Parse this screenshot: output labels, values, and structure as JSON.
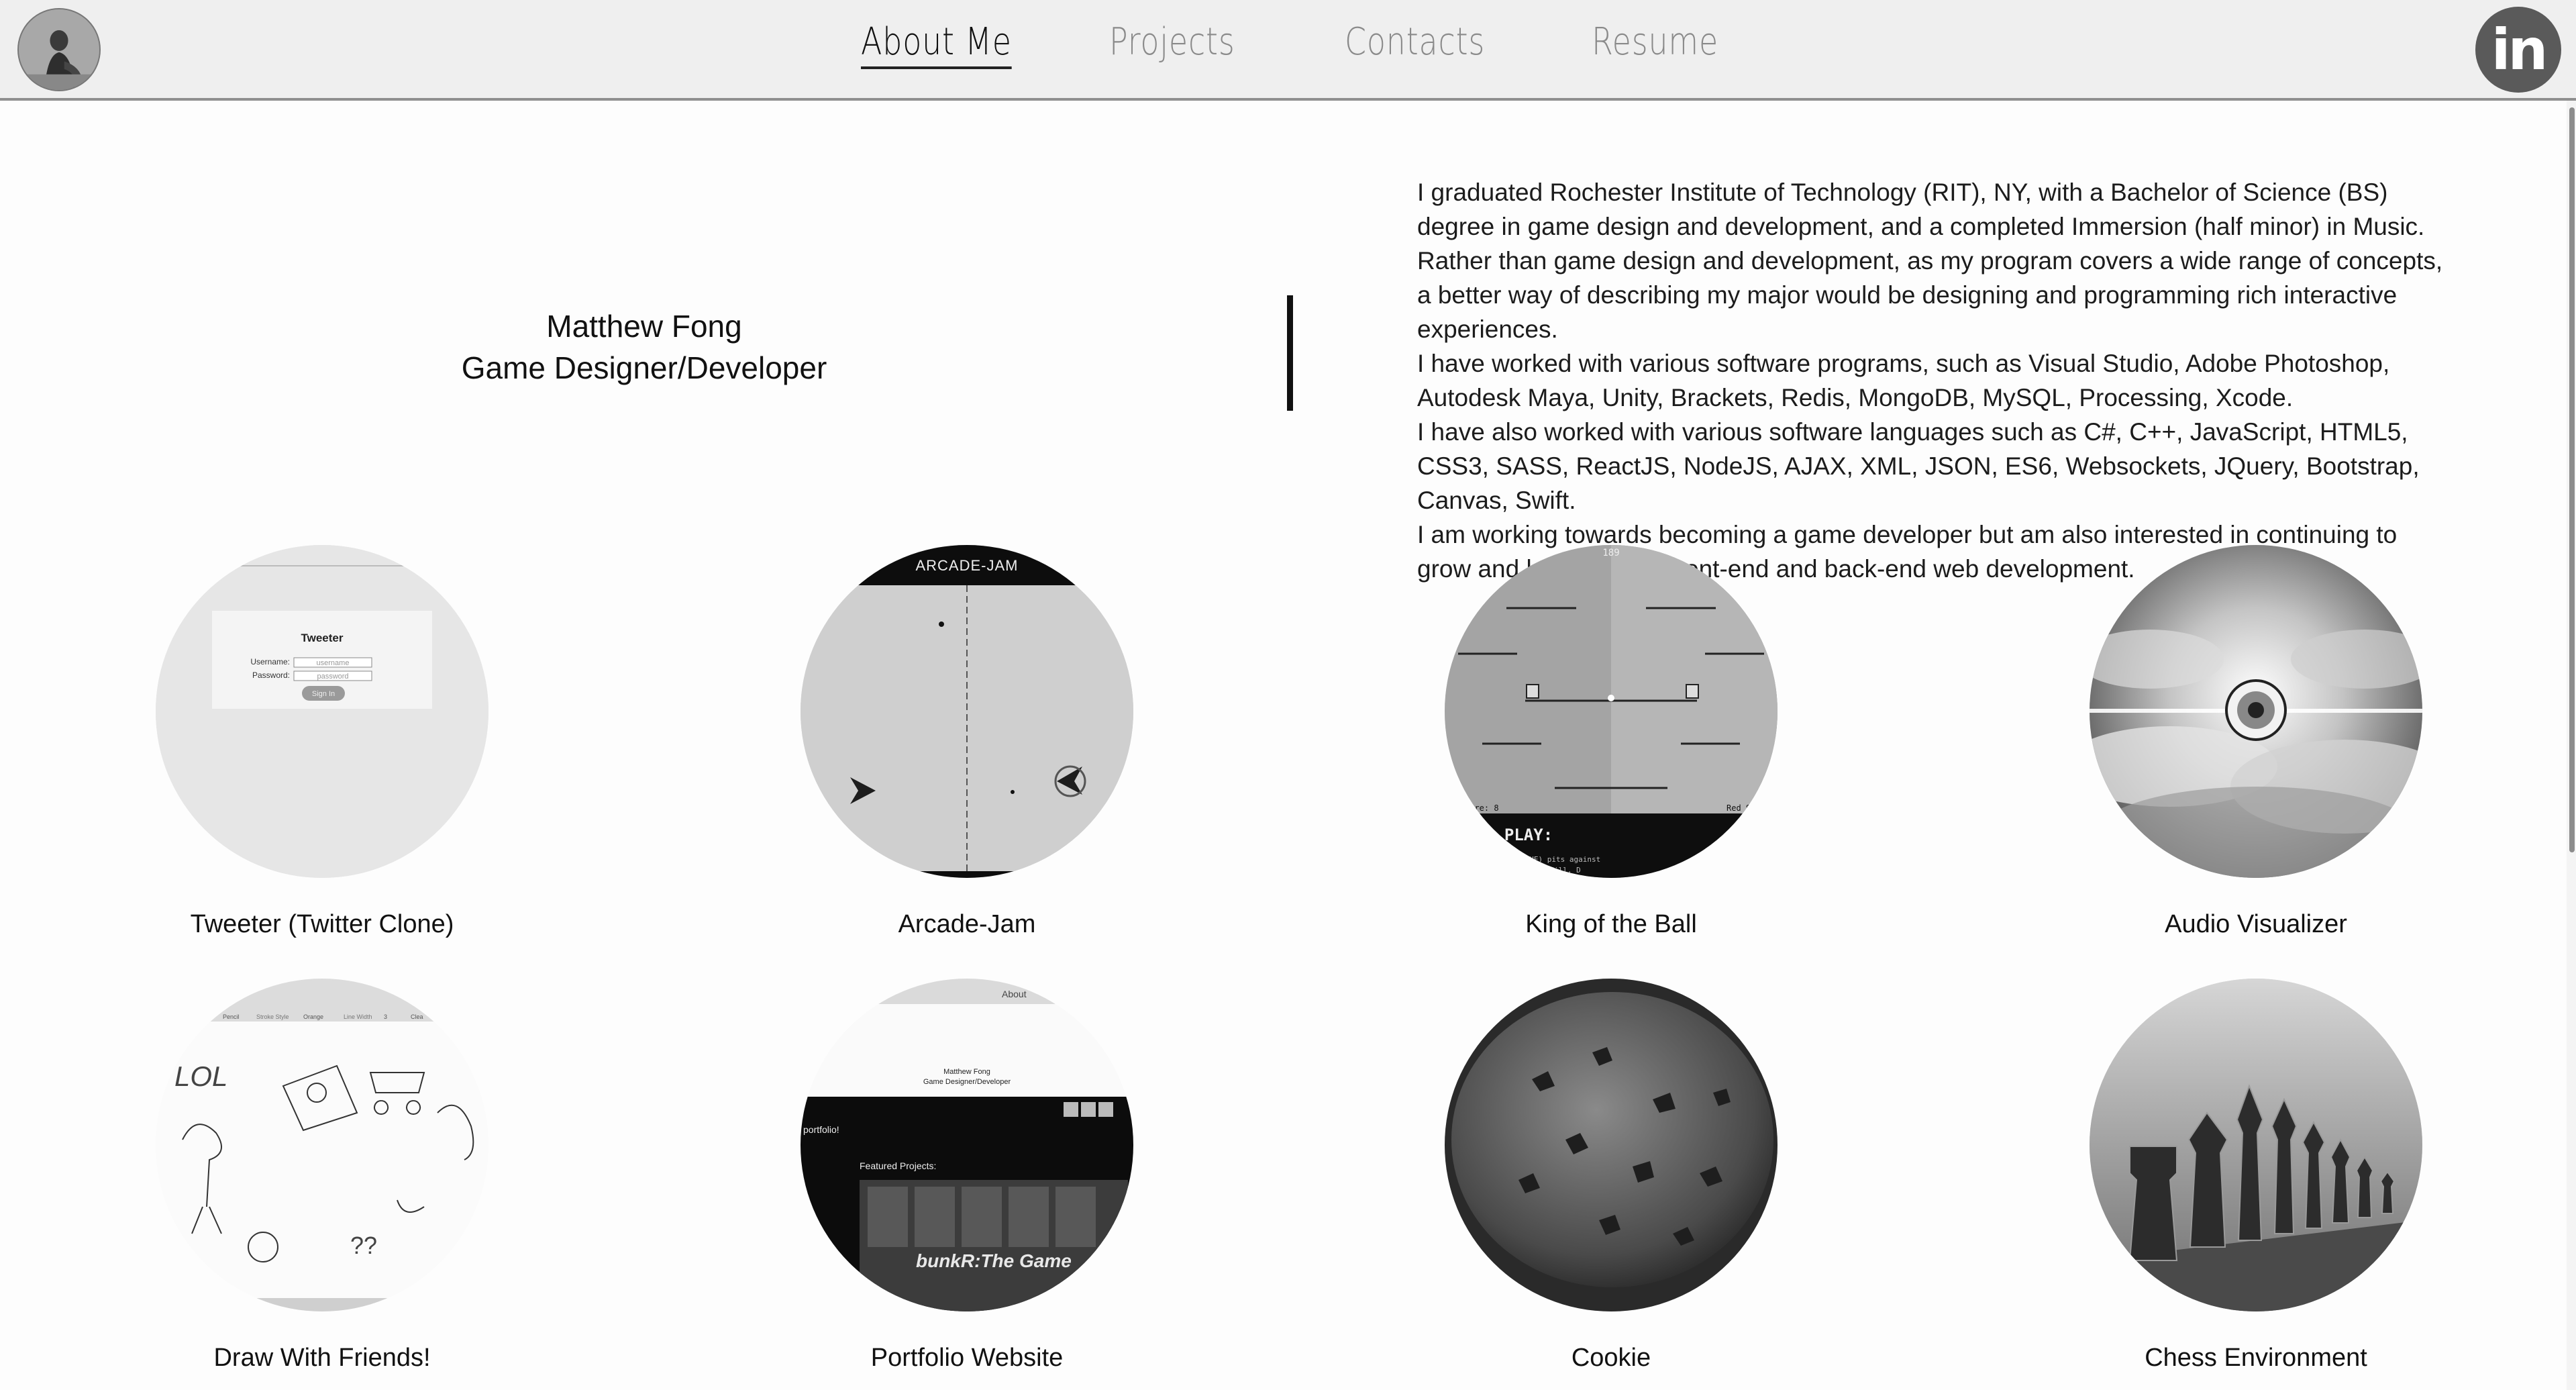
{
  "header": {
    "avatar_icon": "profile-photo",
    "nav": [
      {
        "label": "About Me",
        "active": true
      },
      {
        "label": "Projects",
        "active": false
      },
      {
        "label": "Contacts",
        "active": false
      },
      {
        "label": "Resume",
        "active": false
      }
    ],
    "linkedin_label": "in",
    "linkedin_icon": "linkedin-icon"
  },
  "intro": {
    "name": "Matthew Fong",
    "role": "Game Designer/Developer",
    "bio": [
      "I graduated Rochester Institute of Technology (RIT), NY, with a Bachelor of Science (BS) degree in game design and development, and a completed Immersion (half minor) in Music. Rather than game design and development, as my program covers a wide range of concepts, a better way of describing my major would be designing and programming rich interactive experiences.",
      "I have worked with various software programs, such as Visual Studio, Adobe Photoshop, Autodesk Maya, Unity, Brackets, Redis, MongoDB, MySQL, Processing, Xcode.",
      "I have also worked with various software languages such as C#, C++, JavaScript, HTML5, CSS3, SASS, ReactJS, NodeJS, AJAX, XML, JSON, ES6, Websockets, JQuery, Bootstrap, Canvas, Swift.",
      "I am working towards becoming a game developer but am also interested in continuing to grow and learn in both front-end and back-end web development."
    ]
  },
  "projects": [
    {
      "label": "Tweeter (Twitter Clone)",
      "thumb": {
        "title": "Tweeter",
        "username_label": "Username:",
        "username_placeholder": "username",
        "password_label": "Password:",
        "password_placeholder": "password",
        "button": "Sign In"
      }
    },
    {
      "label": "Arcade-Jam",
      "thumb": {
        "banner": "ARCADE-JAM"
      }
    },
    {
      "label": "King of the Ball",
      "thumb": {
        "score_top": "189",
        "score_left": "core: 8",
        "score_right": "Red Sc",
        "play": "O PLAY:",
        "info": "ayer 2 (BLUE) pits against",
        "info2": "of the Hill. D"
      }
    },
    {
      "label": "Audio Visualizer",
      "thumb": {}
    },
    {
      "label": "Draw With Friends!",
      "thumb": {
        "t1": "Pencil",
        "t2": "Stroke Style",
        "t3": "Orange",
        "t4": "Line Width",
        "t5": "3",
        "t6": "Clea",
        "doodle": "LOL",
        "doodle2": "??"
      }
    },
    {
      "label": "Portfolio Website",
      "thumb": {
        "about": "About",
        "name": "Matthew Fong",
        "role": "Game Designer/Developer",
        "portfolio": "portfolio!",
        "featured": "Featured Projects:",
        "game": "bunkR:The Game"
      }
    },
    {
      "label": "Cookie",
      "thumb": {}
    },
    {
      "label": "Chess Environment",
      "thumb": {}
    }
  ]
}
